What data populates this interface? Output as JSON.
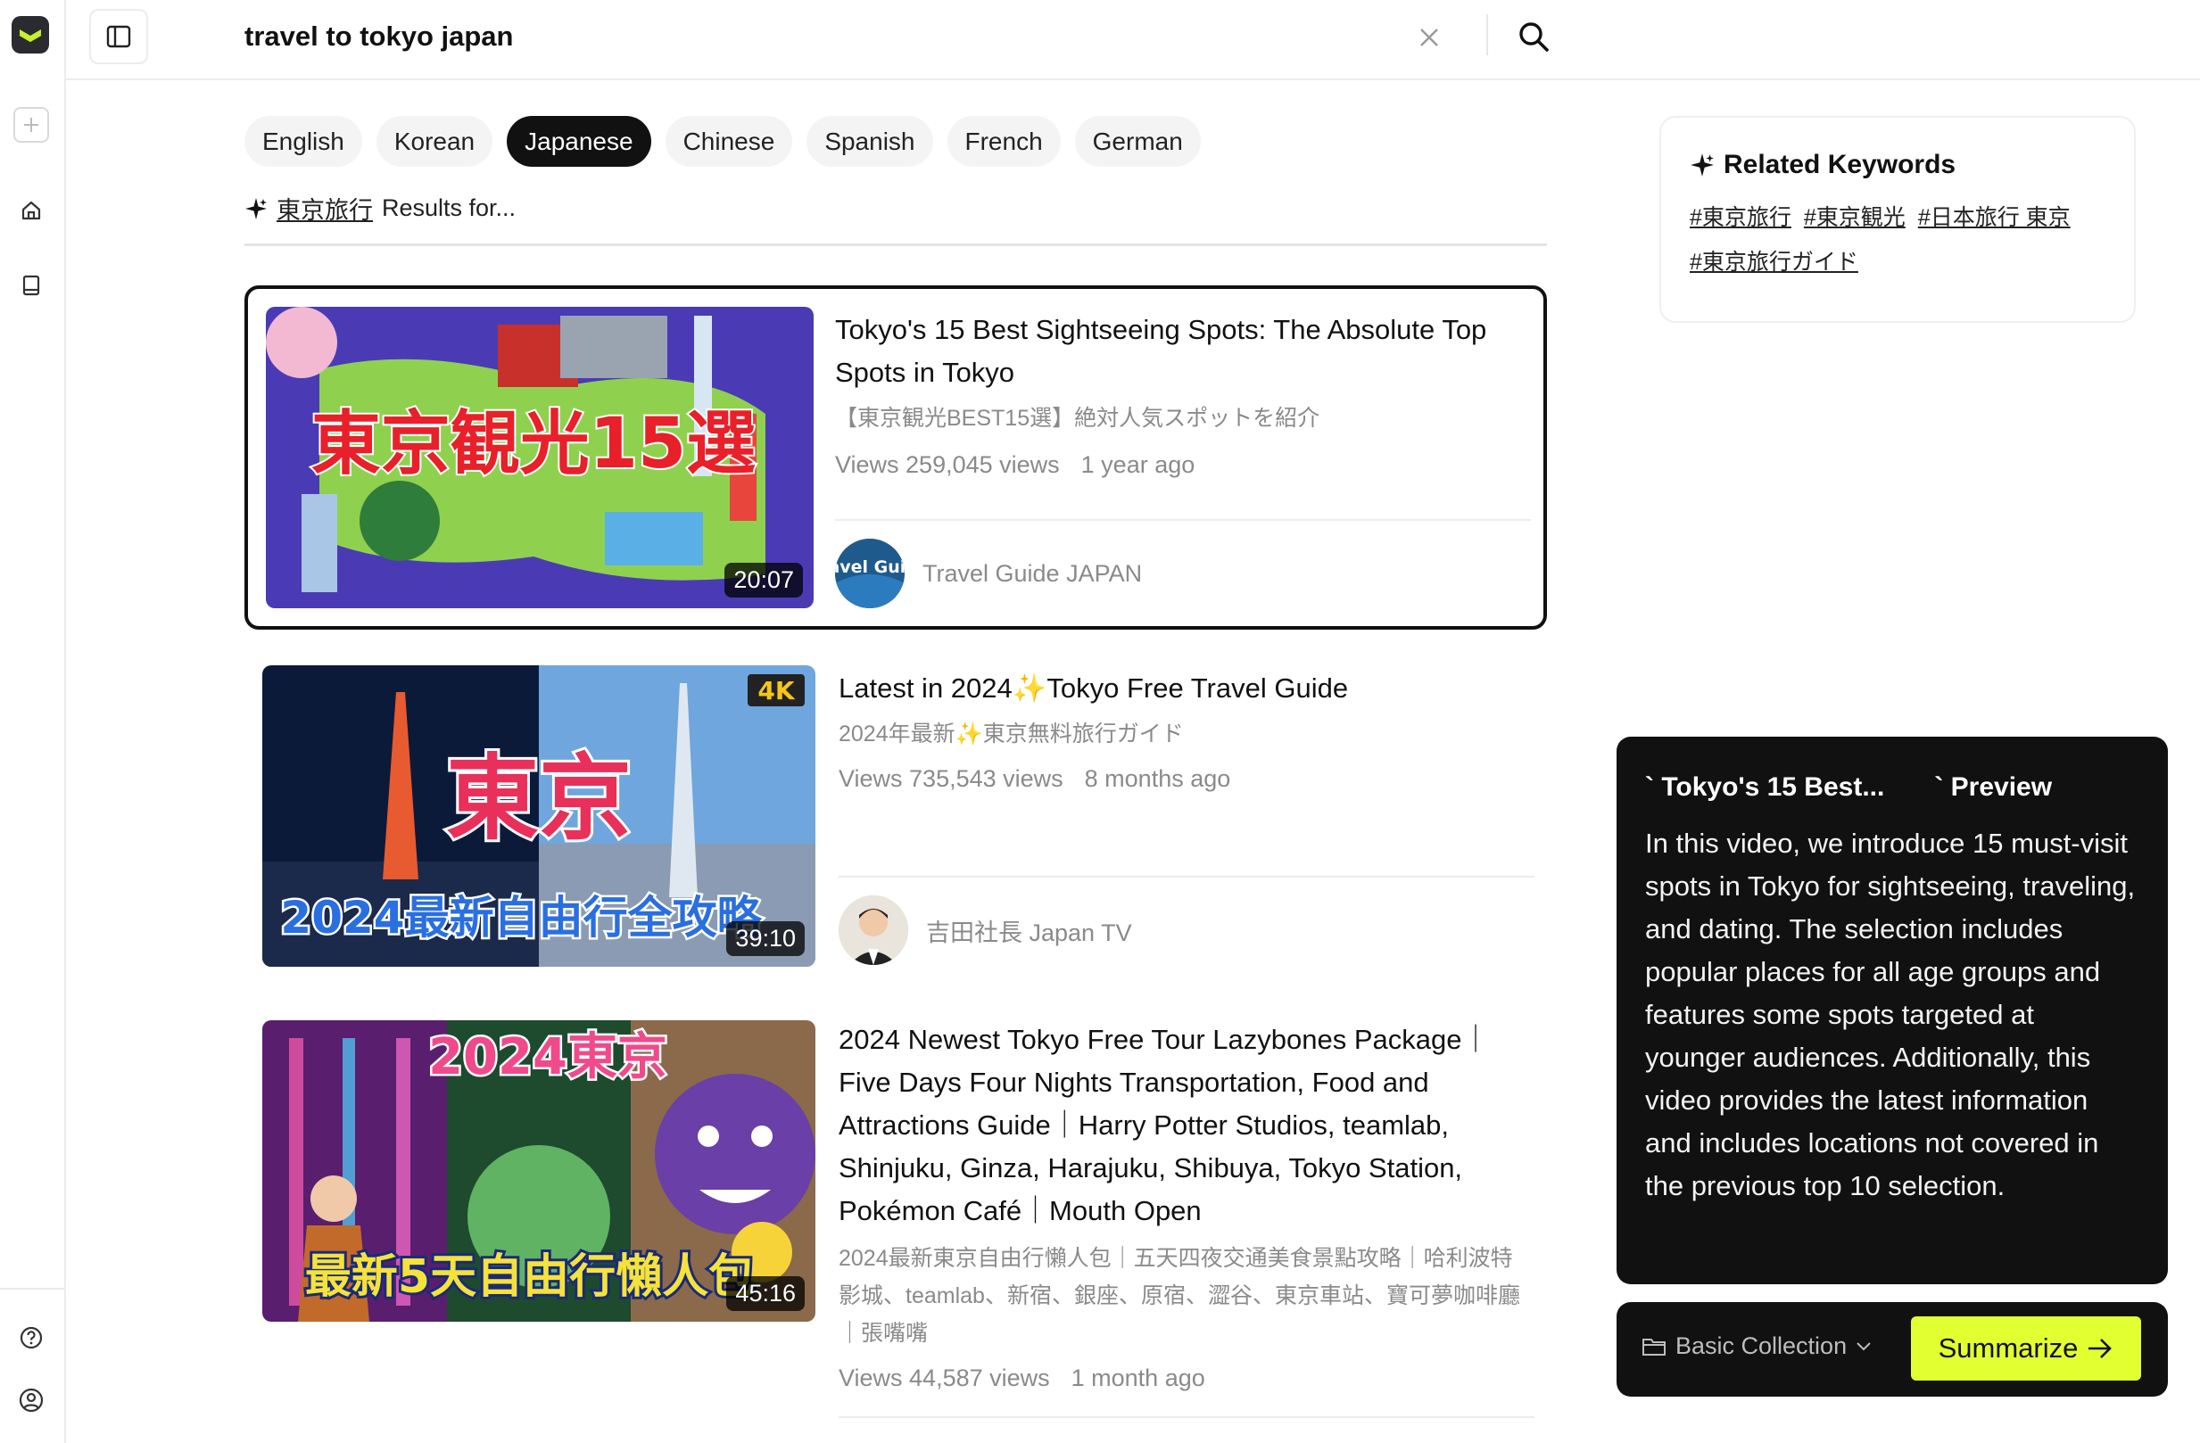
{
  "search": {
    "query": "travel to tokyo japan"
  },
  "languages": [
    {
      "label": "English",
      "active": false
    },
    {
      "label": "Korean",
      "active": false
    },
    {
      "label": "Japanese",
      "active": true
    },
    {
      "label": "Chinese",
      "active": false
    },
    {
      "label": "Spanish",
      "active": false
    },
    {
      "label": "French",
      "active": false
    },
    {
      "label": "German",
      "active": false
    }
  ],
  "results_for": {
    "keyword": "東京旅行",
    "suffix": "Results for..."
  },
  "videos": [
    {
      "title": "Tokyo's 15 Best Sightseeing Spots: The Absolute Top Spots in Tokyo",
      "subtitle": "【東京観光BEST15選】絶対人気スポットを紹介",
      "views": "Views 259,045 views",
      "age": "1 year ago",
      "channel": "Travel Guide JAPAN",
      "duration": "20:07",
      "thumb_text": "東京観光15選",
      "avatar_text": "Travel Guide"
    },
    {
      "title": "Latest in 2024✨Tokyo Free Travel Guide",
      "subtitle": "2024年最新✨東京無料旅行ガイド",
      "views": "Views 735,543 views",
      "age": "8 months ago",
      "channel": "吉田社長 Japan TV",
      "duration": "39:10",
      "thumb_text": "東京",
      "thumb_text2": "2024最新自由行全攻略",
      "badge": "4K"
    },
    {
      "title": "2024 Newest Tokyo Free Tour Lazybones Package｜Five Days Four Nights Transportation, Food and Attractions Guide｜Harry Potter Studios, teamlab, Shinjuku, Ginza, Harajuku, Shibuya, Tokyo Station, Pokémon Café｜Mouth Open",
      "subtitle": "2024最新東京自由行懶人包｜五天四夜交通美食景點攻略｜哈利波特影城、teamlab、新宿、銀座、原宿、澀谷、東京車站、寶可夢咖啡廳｜張嘴嘴",
      "views": "Views 44,587 views",
      "age": "1 month ago",
      "duration": "45:16",
      "thumb_text": "2024東京",
      "thumb_text2": "最新5天自由行懶人包"
    }
  ],
  "related": {
    "heading": "Related Keywords",
    "tags": [
      "#東京旅行",
      "#東京観光",
      "#日本旅行 東京",
      "#東京旅行ガイド"
    ]
  },
  "preview": {
    "title": "` Tokyo's 15 Best...",
    "label": "` Preview",
    "body": "In this video, we introduce 15 must-visit spots in Tokyo for sightseeing, traveling, and dating. The selection includes popular places for all age groups and features some spots targeted at younger audiences. Additionally, this video provides the latest information and includes locations not covered in the previous top 10 selection."
  },
  "actions": {
    "collection": "Basic Collection",
    "summarize": "Summarize"
  },
  "colors": {
    "accent": "#e2ff32",
    "dark": "#111111"
  }
}
